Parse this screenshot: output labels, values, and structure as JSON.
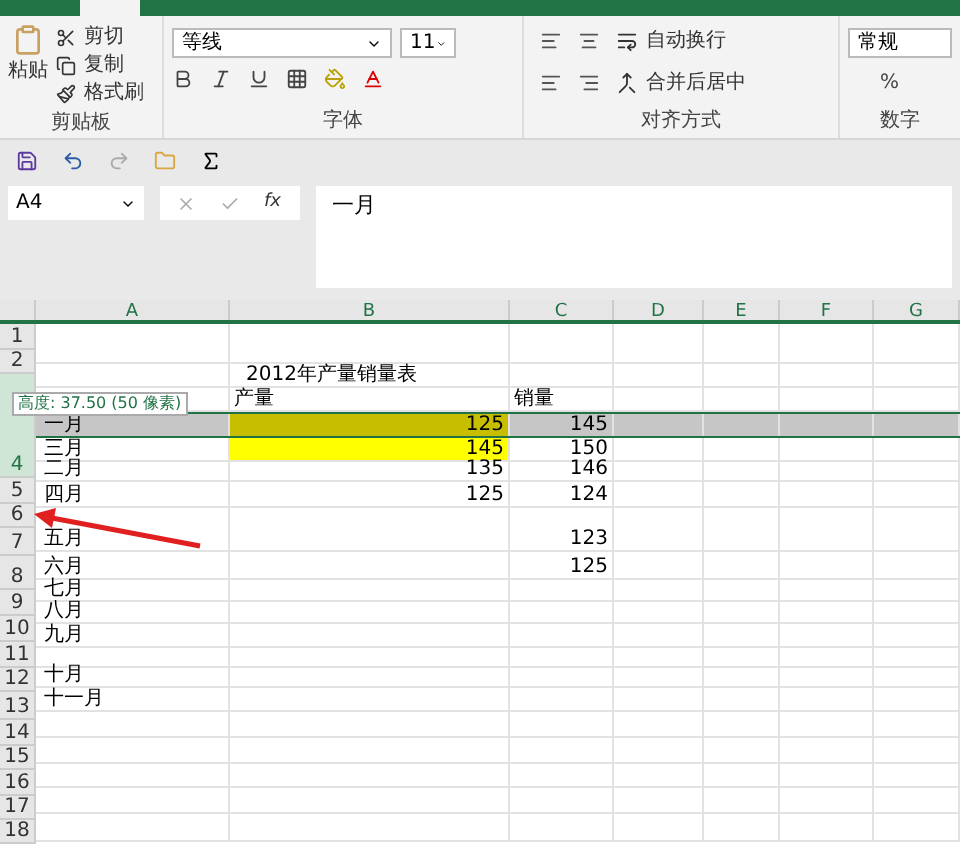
{
  "ribbon": {
    "clipboard": {
      "paste": "粘贴",
      "cut": "剪切",
      "copy": "复制",
      "format_painter": "格式刷",
      "label": "剪贴板"
    },
    "font": {
      "font_name": "等线",
      "font_size": "11",
      "label": "字体"
    },
    "alignment": {
      "wrap_text": "自动换行",
      "merge_center": "合并后居中",
      "label": "对齐方式"
    },
    "number": {
      "format": "常规",
      "percent": "%",
      "label": "数字"
    }
  },
  "formula_bar": {
    "name_box": "A4",
    "fx": "fx",
    "content": "一月"
  },
  "columns": [
    "A",
    "B",
    "C",
    "D",
    "E",
    "F",
    "G"
  ],
  "row_headers": [
    {
      "label": "1",
      "selected": false
    },
    {
      "label": "2",
      "selected": false
    },
    {
      "label": "4",
      "selected": true
    },
    {
      "label": "5",
      "selected": false
    },
    {
      "label": "6",
      "selected": false
    },
    {
      "label": "7",
      "selected": false
    },
    {
      "label": "8",
      "selected": false
    },
    {
      "label": "9",
      "selected": false
    },
    {
      "label": "10",
      "selected": false
    },
    {
      "label": "11",
      "selected": false
    },
    {
      "label": "12",
      "selected": false
    },
    {
      "label": "13",
      "selected": false
    },
    {
      "label": "14",
      "selected": false
    },
    {
      "label": "15",
      "selected": false
    },
    {
      "label": "16",
      "selected": false
    },
    {
      "label": "17",
      "selected": false
    },
    {
      "label": "18",
      "selected": false
    }
  ],
  "rows": [
    {
      "selected": false
    },
    {
      "b": "2012年产量销量表",
      "selected": false
    },
    {
      "b": "产量",
      "c": "销量",
      "selected": false
    },
    {
      "a": "一月",
      "b": "125",
      "c": "145",
      "color": "#c8be00",
      "selected": true
    },
    {
      "a": "三月",
      "b": "145",
      "c": "150",
      "color": "#ffff00",
      "selected": false
    },
    {
      "a": "二月",
      "b": "135",
      "c": "146",
      "selected": false
    },
    {
      "a": "四月",
      "b": "125",
      "c": "124",
      "selected": false
    },
    {
      "a": "五月",
      "c": "123",
      "selected": false
    },
    {
      "a": "六月",
      "c": "125",
      "selected": false
    },
    {
      "a": "七月",
      "selected": false
    },
    {
      "a": "八月",
      "selected": false
    },
    {
      "a": "九月",
      "selected": false
    },
    {
      "selected": false
    },
    {
      "a": "十月",
      "selected": false
    },
    {
      "a": "十一月",
      "selected": false
    },
    {
      "selected": false
    },
    {
      "selected": false
    },
    {
      "selected": false
    },
    {
      "selected": false
    },
    {
      "selected": false
    }
  ],
  "tooltip": "高度: 37.50 (50 像素)"
}
